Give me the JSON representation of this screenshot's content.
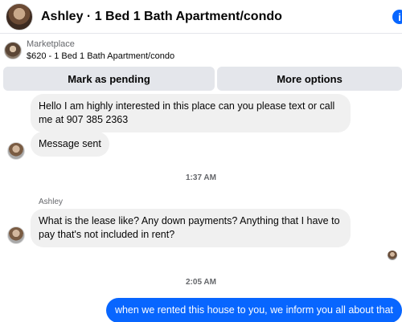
{
  "header": {
    "title": "Ashley · 1 Bed 1 Bath Apartment/condo",
    "info_icon": "i"
  },
  "listing": {
    "source": "Marketplace",
    "title": "$620 - 1 Bed 1 Bath Apartment/condo"
  },
  "actions": {
    "mark_pending": "Mark as pending",
    "more_options": "More options"
  },
  "messages": [
    {
      "text": "Hello I am highly interested in this place can you please text or call me at 907 385 2363"
    },
    {
      "text": "Message sent"
    }
  ],
  "timestamps": [
    "1:37 AM",
    "2:05 AM"
  ],
  "thread": {
    "sender_name": "Ashley",
    "question": "What is the lease like? Any down payments? Anything that I have to pay that's not included in rent?",
    "reply": "when we rented this house to you, we inform you all about that"
  }
}
